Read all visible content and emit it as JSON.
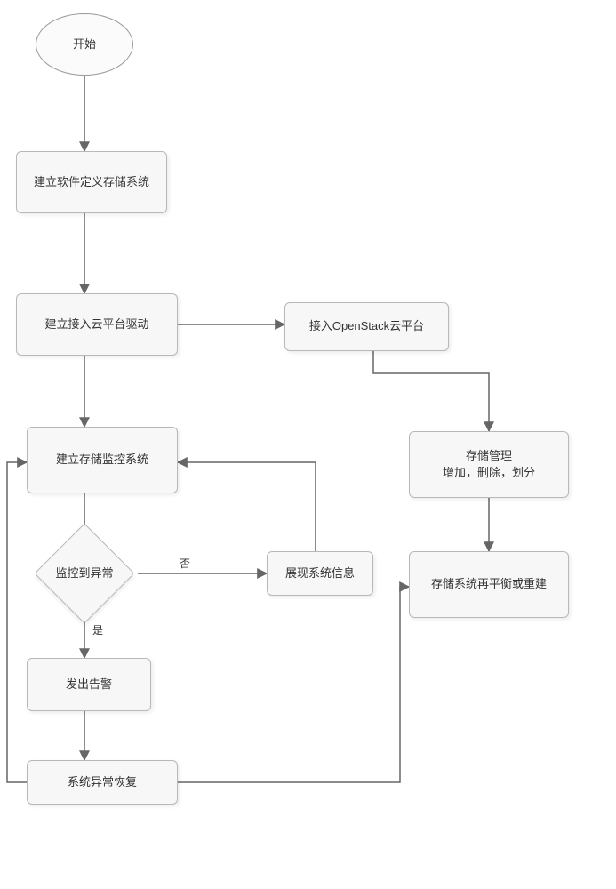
{
  "start": "开始",
  "build_sds": "建立软件定义存储系统",
  "build_driver": "建立接入云平台驱动",
  "connect_openstack": "接入OpenStack云平台",
  "build_monitor": "建立存储监控系统",
  "decision": "监控到异常",
  "edge_no": "否",
  "edge_yes": "是",
  "show_info": "展现系统信息",
  "alarm": "发出告警",
  "recover": "系统异常恢复",
  "storage_mgmt": "存储管理\n增加，删除，划分",
  "rebalance": "存储系统再平衡或重建"
}
